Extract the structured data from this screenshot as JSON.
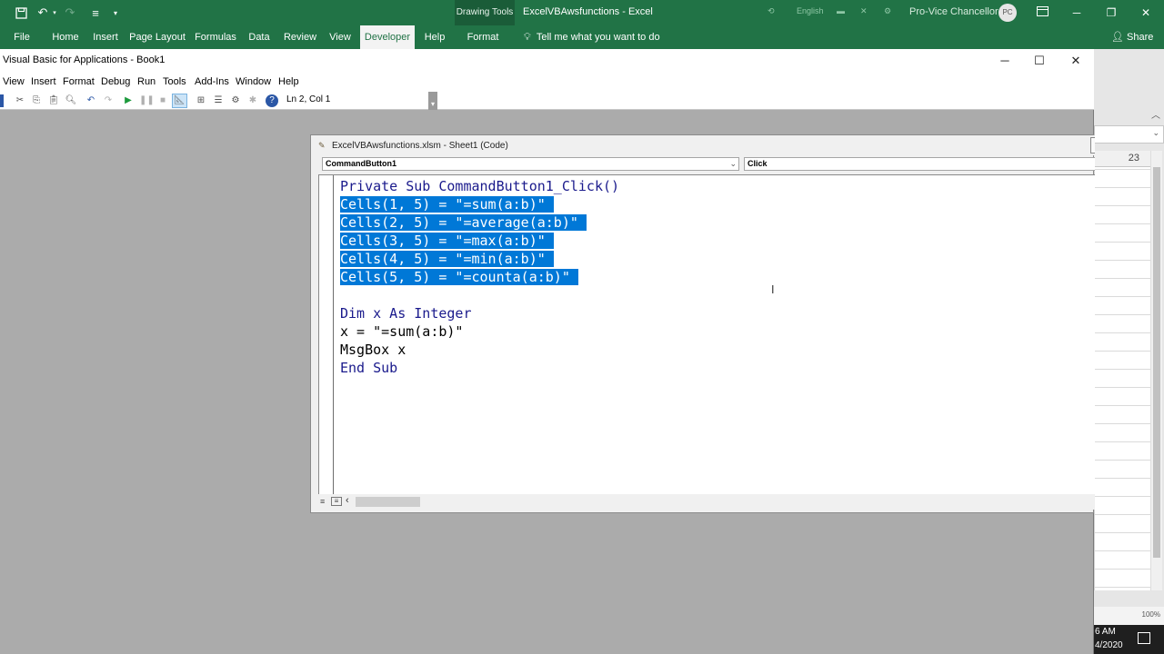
{
  "excel": {
    "context_tab": "Drawing Tools",
    "title": "ExcelVBAwsfunctions  -  Excel",
    "language": "English",
    "user": "Pro-Vice Chancellor",
    "user_initials": "PC",
    "tabs": [
      "File",
      "Home",
      "Insert",
      "Page Layout",
      "Formulas",
      "Data",
      "Review",
      "View",
      "Developer",
      "Help",
      "Format"
    ],
    "active_tab": "Developer",
    "tell_me": "Tell me what you want to do",
    "share": "Share",
    "column_header": "23",
    "zoom": "100%",
    "clock_time": "6 AM",
    "clock_date": "4/2020"
  },
  "vbe": {
    "title": "Visual Basic for Applications - Book1",
    "menu": [
      "View",
      "Insert",
      "Format",
      "Debug",
      "Run",
      "Tools",
      "Add-Ins",
      "Window",
      "Help"
    ],
    "cursor_position": "Ln 2, Col 1",
    "code_window": {
      "title": "ExcelVBAwsfunctions.xlsm - Sheet1 (Code)",
      "object_combo": "CommandButton1",
      "procedure_combo": "Click",
      "lines": [
        {
          "text": "Private Sub CommandButton1_Click()",
          "selected": false,
          "keyword": true
        },
        {
          "text": "Cells(1, 5) = \"=sum(a:b)\" ",
          "selected": true,
          "keyword": false
        },
        {
          "text": "Cells(2, 5) = \"=average(a:b)\" ",
          "selected": true,
          "keyword": false
        },
        {
          "text": "Cells(3, 5) = \"=max(a:b)\" ",
          "selected": true,
          "keyword": false
        },
        {
          "text": "Cells(4, 5) = \"=min(a:b)\" ",
          "selected": true,
          "keyword": false
        },
        {
          "text": "Cells(5, 5) = \"=counta(a:b)\" ",
          "selected": true,
          "keyword": false
        },
        {
          "text": "",
          "selected": false,
          "keyword": false
        },
        {
          "text": "Dim x As Integer",
          "selected": false,
          "keyword": true
        },
        {
          "text": "x = \"=sum(a:b)\"",
          "selected": false,
          "keyword": false
        },
        {
          "text": "MsgBox x",
          "selected": false,
          "keyword": false
        },
        {
          "text": "End Sub",
          "selected": false,
          "keyword": true
        }
      ]
    }
  },
  "icons": {
    "save": "save-icon",
    "undo": "undo-icon",
    "redo": "redo-icon",
    "customize": "customize-icon",
    "minimize": "minimize-icon",
    "maximize": "maximize-icon",
    "close": "close-icon",
    "lightbulb": "lightbulb-icon",
    "share": "share-icon",
    "ribbon_display": "ribbon-display-icon"
  }
}
